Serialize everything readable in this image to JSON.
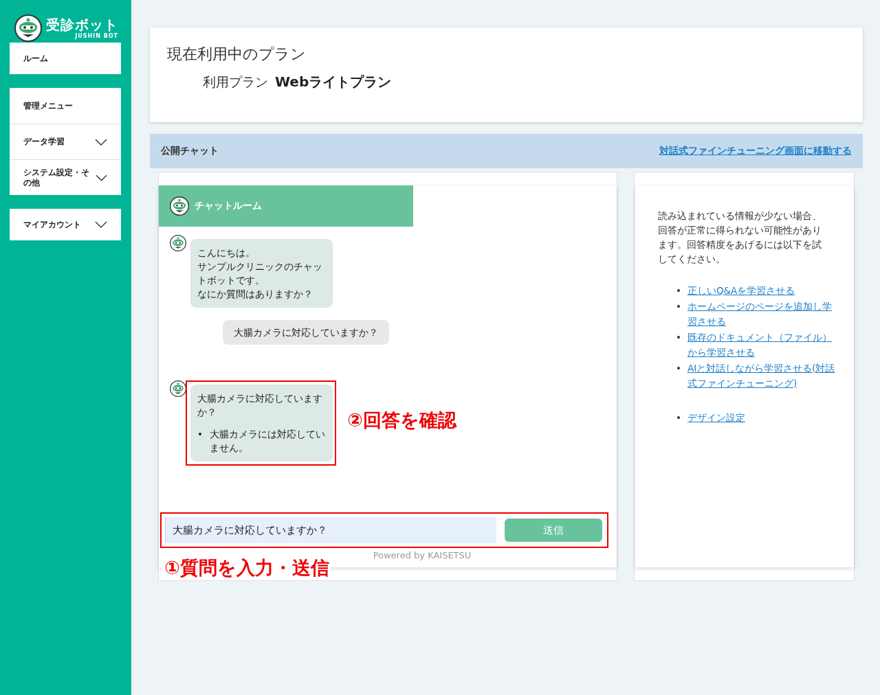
{
  "sidebar": {
    "logo": {
      "title": "受診ボット",
      "subtitle": "JUSHIN BOT"
    },
    "groups": [
      [
        {
          "label": "ルーム",
          "has_submenu": false
        }
      ],
      [
        {
          "label": "管理メニュー",
          "has_submenu": false
        },
        {
          "label": "データ学習",
          "has_submenu": true
        },
        {
          "label": "システム設定・その他",
          "has_submenu": true
        }
      ],
      [
        {
          "label": "マイアカウント",
          "has_submenu": true
        }
      ]
    ]
  },
  "plan": {
    "title": "現在利用中のプラン",
    "label": "利用プラン",
    "value": "Webライトプラン"
  },
  "section": {
    "title": "公開チャット",
    "link": "対話式ファインチューニング画面に移動する"
  },
  "chat": {
    "title": "チャットルーム",
    "messages": [
      {
        "kind": "bot",
        "lines": [
          "こんにちは。",
          "サンプルクリニックのチャットボットです。",
          "なにか質問はありますか？"
        ],
        "highlighted": false
      },
      {
        "kind": "user",
        "text": "大腸カメラに対応していますか？",
        "highlighted": false
      },
      {
        "kind": "bot",
        "lines": [
          "大腸カメラに対応していますか？"
        ],
        "bullet_marker": "•",
        "bullets": [
          "大腸カメラには対応していません。"
        ],
        "highlighted": true,
        "annotation": "②回答を確認"
      }
    ],
    "input": {
      "value": "大腸カメラに対応していますか？",
      "highlighted": true,
      "annotation": "①質問を入力・送信"
    },
    "send_button": "送信",
    "powered_by": "Powered by KAISETSU"
  },
  "tips": {
    "marker": "•",
    "text": "読み込まれている情報が少ない場合、回答が正常に得られない可能性があります。回答精度をあげるには以下を試してください。",
    "links": [
      "正しいQ&Aを学習させる",
      "ホームページのページを追加し学習させる",
      "既存のドキュメント（ファイル）から学習させる",
      "AIと対話しながら学習させる(対話式ファインチューニング)"
    ],
    "extra_links": [
      "デザイン設定"
    ]
  }
}
